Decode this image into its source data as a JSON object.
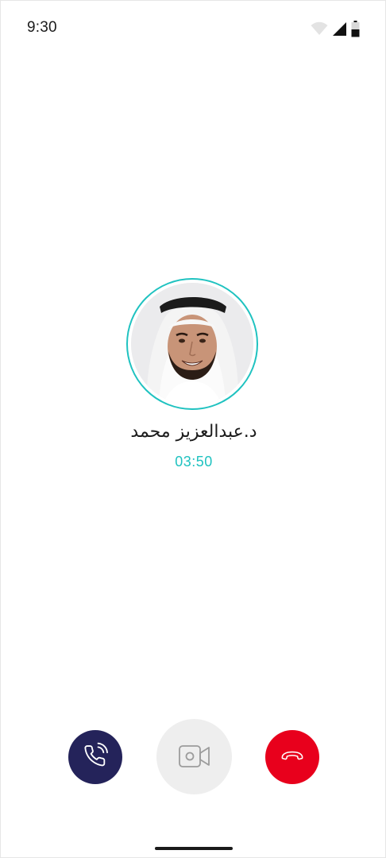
{
  "status_bar": {
    "time": "9:30",
    "icons": [
      "wifi-icon",
      "cellular-signal-icon",
      "battery-icon"
    ]
  },
  "caller": {
    "name": "د.عبدالعزيز محمد",
    "timer": "03:50",
    "avatar": "caller-photo",
    "ring_color": "#1fc2c0"
  },
  "controls": {
    "voice": {
      "icon": "phone-ringing-icon",
      "color": "#24235a"
    },
    "video": {
      "icon": "video-camera-icon",
      "color": "#eeeeee",
      "state": "disabled"
    },
    "end": {
      "icon": "hang-up-icon",
      "color": "#e8001c"
    }
  },
  "colors": {
    "accent": "#1fc2c0",
    "primary": "#24235a",
    "danger": "#e8001c"
  }
}
